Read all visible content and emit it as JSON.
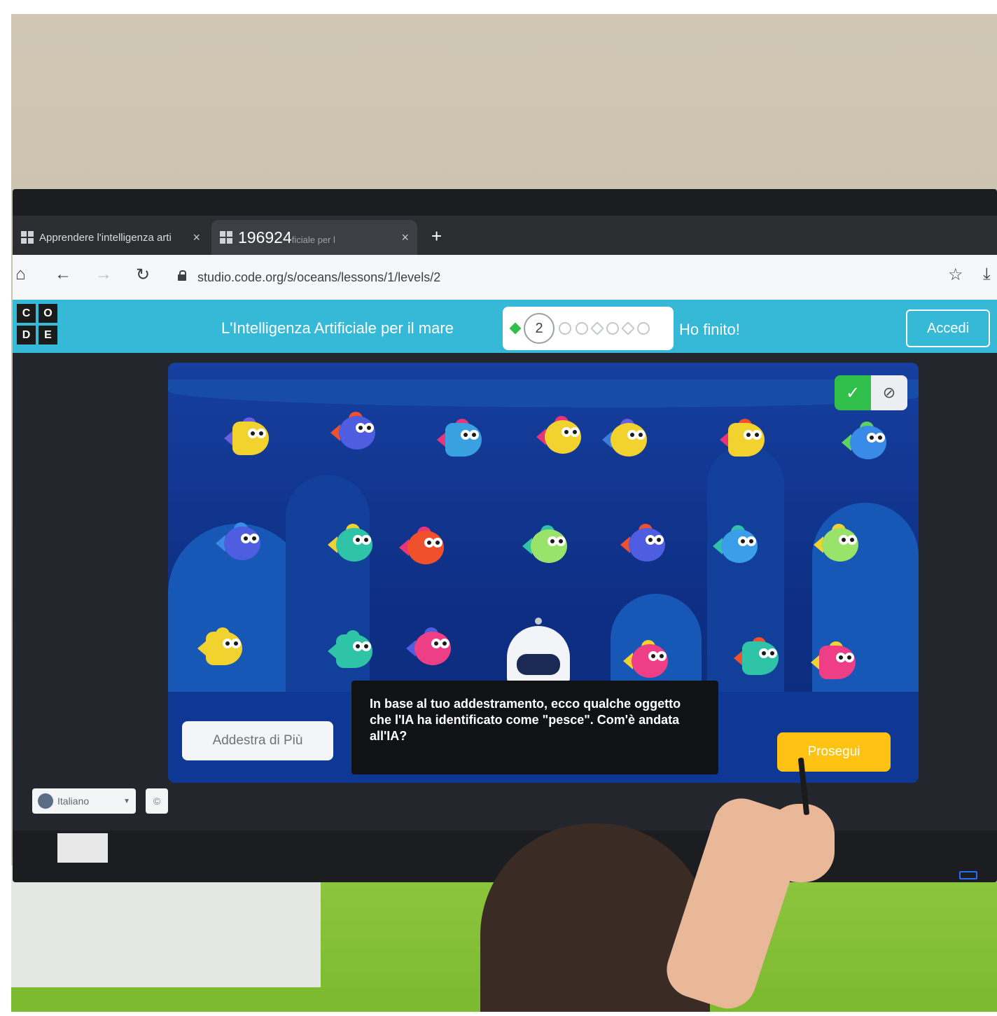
{
  "browser": {
    "tabs": [
      {
        "label": "Apprendere l'intelligenza arti"
      },
      {
        "label": "196924",
        "suffix": "ficiale per l"
      }
    ],
    "new_tab": "+",
    "close": "×",
    "url": "studio.code.org/s/oceans/lessons/1/levels/2"
  },
  "header": {
    "logo_letters": [
      "C",
      "O",
      "D",
      "E"
    ],
    "lesson_title": "L'Intelligenza Artificiale per il mare",
    "current_level": "2",
    "finished_label": "Ho finito!",
    "sign_in_label": "Accedi"
  },
  "ocean": {
    "toggle_yes_icon": "check-icon",
    "toggle_no_icon": "ban-icon",
    "train_more_label": "Addestra di Più",
    "dialog_text": "In base al tuo addestramento, ecco qualche oggetto che l'IA ha identificato come \"pesce\". Com'è andata all'IA?",
    "continue_label": "Prosegui"
  },
  "footer": {
    "language": "Italiano",
    "copyright": "©"
  },
  "colors": {
    "header_bg": "#36b9d7",
    "ocean_bg": "#163f9f",
    "continue_bg": "#ffc212",
    "toggle_yes_bg": "#2fbf4a"
  }
}
